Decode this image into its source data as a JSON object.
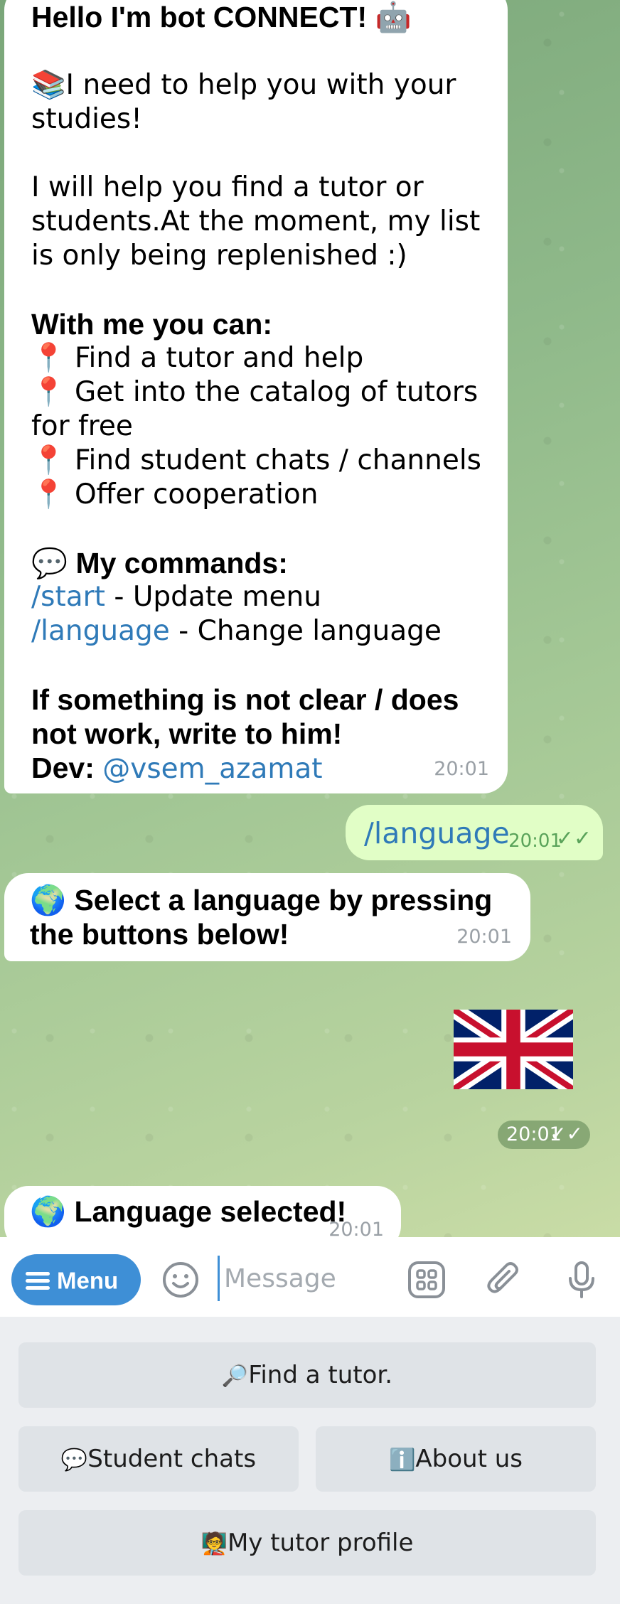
{
  "messages": {
    "welcome": {
      "line1": "Hello I'm bot CONNECT! 🤖",
      "line2": "📚I need to help you with your studies!",
      "line3": "I will help you find a tutor or students.At the moment, my list is only being replenished :)",
      "can_header": "With me you can:",
      "items": [
        "📍 Find a tutor and help",
        "📍 Get into the catalog of tutors for free",
        "📍 Find student chats / channels",
        "📍 Offer cooperation"
      ],
      "commands_header": "💬 My commands:",
      "cmd1": "/start",
      "cmd1_desc": " - Update menu",
      "cmd2": "/language",
      "cmd2_desc": " - Change language",
      "help_line": "If something is not clear / does not work, write to him!",
      "dev_label": "Dev: ",
      "dev_link": "@vsem_azamat",
      "time": "20:01"
    },
    "outgoing_command": {
      "text": "/language",
      "time": "20:01",
      "ticks": "✓✓"
    },
    "select_language": {
      "text": "🌍 Select a language by pressing the buttons below!",
      "time": "20:01"
    },
    "sticker": {
      "time": "20:01",
      "ticks": "✓✓"
    },
    "language_selected": {
      "text": "🌍 Language selected!",
      "time": "20:01"
    }
  },
  "input_bar": {
    "menu_label": "Menu",
    "placeholder": "Message"
  },
  "keyboard": {
    "find_tutor": "Find a tutor.",
    "student_chats": "Student chats",
    "about_us": "About us",
    "my_profile": "My tutor profile",
    "find_tutor_icon": "🔎",
    "student_chats_icon": "💬",
    "about_us_icon": "ℹ️",
    "my_profile_icon": "🧑‍🏫"
  },
  "colors": {
    "accent": "#3e8fd6",
    "link": "#2f7ab8",
    "outgoing_bubble": "#e1fec6"
  }
}
